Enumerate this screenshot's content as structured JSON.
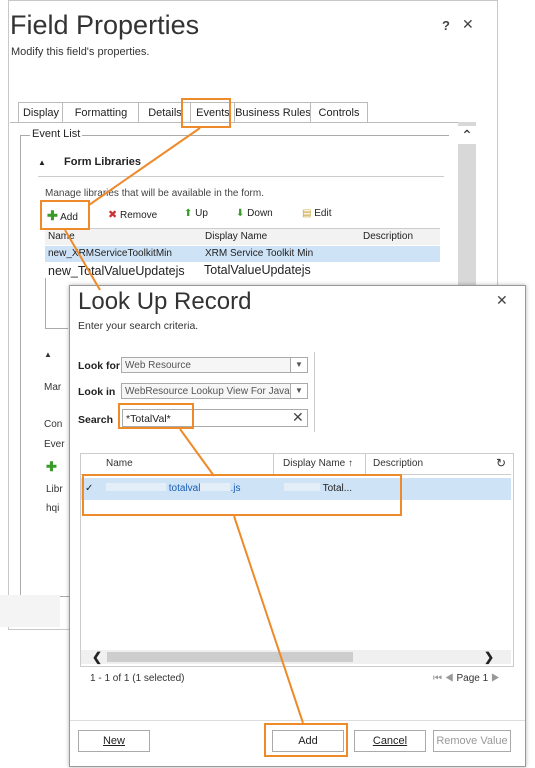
{
  "field_properties": {
    "title": "Field Properties",
    "subtitle": "Modify this field's properties.",
    "help": "?",
    "close": "✕",
    "tabs": [
      "Display",
      "Formatting",
      "Details",
      "Events",
      "Business Rules",
      "Controls"
    ],
    "event_list_label": "Event List",
    "form_libraries_label": "Form Libraries",
    "manage_text": "Manage libraries that will be available in the form.",
    "toolbar": {
      "add": "Add",
      "remove": "Remove",
      "up": "Up",
      "down": "Down",
      "edit": "Edit"
    },
    "grid_headers": {
      "name": "Name",
      "display_name": "Display Name",
      "description": "Description"
    },
    "rows": [
      {
        "name": "new_XRMServiceToolkitMin",
        "display_name": "XRM Service Toolkit Min"
      },
      {
        "name": "new_TotalValueUpdatejs",
        "display_name": "TotalValueUpdatejs"
      }
    ],
    "fragments": [
      "Mar",
      "Con",
      "Ever",
      "Libr",
      "hqi"
    ]
  },
  "lookup": {
    "title": "Look Up Record",
    "subtitle": "Enter your search criteria.",
    "close": "✕",
    "look_for_label": "Look for",
    "look_for_value": "Web Resource",
    "look_in_label": "Look in",
    "look_in_value": "WebResource Lookup View For Java Sc",
    "search_label": "Search",
    "search_value": "*TotalVal*",
    "columns": {
      "name": "Name",
      "display_name": "Display Name ↑",
      "description": "Description"
    },
    "result_row": {
      "check": "✓",
      "name": "totalval",
      "display_name": "Total..."
    },
    "count_text": "1 - 1 of 1 (1 selected)",
    "pager_text": "Page 1",
    "buttons": {
      "new": "New",
      "add": "Add",
      "cancel": "Cancel",
      "remove_value": "Remove Value"
    }
  },
  "colors": {
    "highlight": "#ef8a2a",
    "selection": "#cfe3f7"
  }
}
